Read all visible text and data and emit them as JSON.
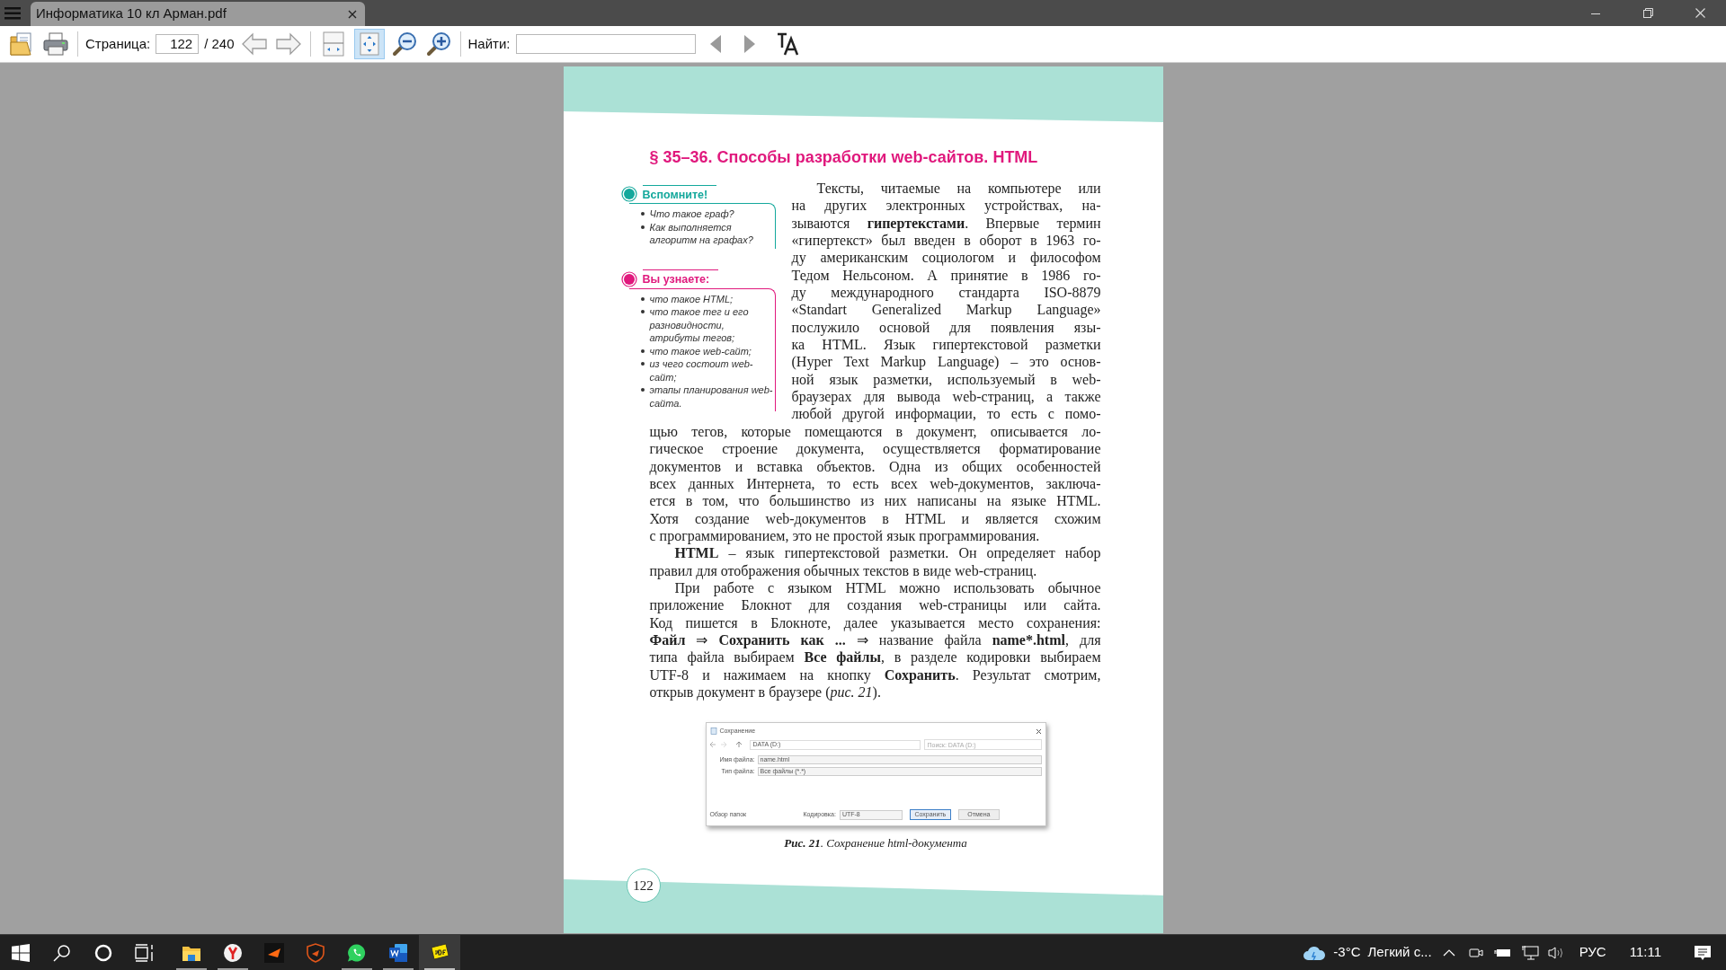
{
  "window": {
    "tab_title": "Информатика 10 кл Арман.pdf"
  },
  "toolbar": {
    "page_label": "Страница:",
    "page_value": "122",
    "page_total": "/ 240",
    "find_label": "Найти:",
    "view_buttons": [
      {
        "kind": "fit-page",
        "selected": false
      },
      {
        "kind": "fit-width",
        "selected": true
      }
    ]
  },
  "page": {
    "title": "§ 35–36. Способы разработки web-сайтов. HTML",
    "callouts": [
      {
        "kind": "remember",
        "heading": "Вспомните!",
        "items": [
          "Что такое граф?",
          "Как выполняется алгоритм на графах?"
        ]
      },
      {
        "kind": "learn",
        "heading": "Вы узнаете:",
        "items": [
          "что такое HTML;",
          "что такое тег и его разновидности, атрибуты тегов;",
          "что такое web-сайт;",
          "из чего состоит web-сайт;",
          "этапы планирования web-сайта."
        ]
      }
    ],
    "paragraphs": [
      {
        "wrapped_lines": [
          "Тексты, читаемые на компьютере или",
          "на других электронных устройствах, на-",
          "зываются **гипертекстами**. Впервые термин",
          "«гипертекст» был введен в оборот в 1963 го-",
          "ду американским социологом и философом",
          "Тедом Нельсоном. А принятие в 1986 го-",
          "ду международного стандарта ISO-8879",
          "«Standart Generalized Markup Language»",
          "послужило основой для появления язы-",
          "ка HTML. Язык гипертекстовой разметки",
          "(Hyper Text Markup Language) – это основ-",
          "ной язык разметки, используемый в web-",
          "браузерах для вывода web-страниц, а также",
          "любой другой информации, то есть с помо-"
        ],
        "lines": [
          "щью тегов, которые помещаются в документ, описывается ло-",
          "гическое строение документа, осуществляется форматирование",
          "документов и вставка объектов. Одна из общих особенностей",
          "всех данных Интернета, то есть всех web-документов, заключа-",
          "ется в том, что большинство из них написаны на языке HTML.",
          "Хотя создание web-документов в HTML и является схожим",
          "с программированием, это не простой язык программирования."
        ]
      },
      {
        "lines": [
          "**HTML** – язык гипертекстовой разметки. Он определяет набор",
          "правил для отображения обычных текстов в виде web-страниц."
        ]
      },
      {
        "lines": [
          "При работе с языком HTML можно использовать обычное",
          "приложение Блокнот для создания web-страницы или сайта.",
          "Код пишется в Блокноте, далее указывается место сохранения:",
          "**Файл** ⇒ **Сохранить как ...** ⇒ название файла **name*.html**, для",
          "типа файла выбираем **Все файлы**, в разделе кодировки выбираем",
          "UTF-8 и нажимаем на кнопку **Сохранить**. Результат смотрим,",
          "открыв документ в браузере (*рис. 21*)."
        ]
      }
    ],
    "figure": {
      "dialog": {
        "title": "Сохранение",
        "path": "DATA (D:)",
        "search_placeholder": "Поиск: DATA (D:)",
        "name_label": "Имя файла:",
        "name_value": "name.html",
        "type_label": "Тип файла:",
        "type_value": "Все файлы (*.*)",
        "browse": "Обзор папок",
        "encoding_label": "Кодировка:",
        "encoding_value": "UTF-8",
        "save": "Сохранить",
        "cancel": "Отмена"
      },
      "caption": "**Рис. 21**. Сохранение html-документа"
    },
    "page_number": "122"
  },
  "taskbar": {
    "apps": [
      {
        "kind": "explorer",
        "running": true,
        "selected": false
      },
      {
        "kind": "browser",
        "running": true,
        "selected": false
      },
      {
        "kind": "arrow-app",
        "running": false,
        "selected": false
      },
      {
        "kind": "shield-app",
        "running": false,
        "selected": false
      },
      {
        "kind": "chat",
        "running": true,
        "selected": false
      },
      {
        "kind": "word",
        "running": true,
        "selected": false
      },
      {
        "kind": "pdf",
        "running": true,
        "selected": true
      }
    ],
    "temperature": "-3°C",
    "weather": "Легкий с...",
    "language": "РУС",
    "time": "11:11"
  }
}
